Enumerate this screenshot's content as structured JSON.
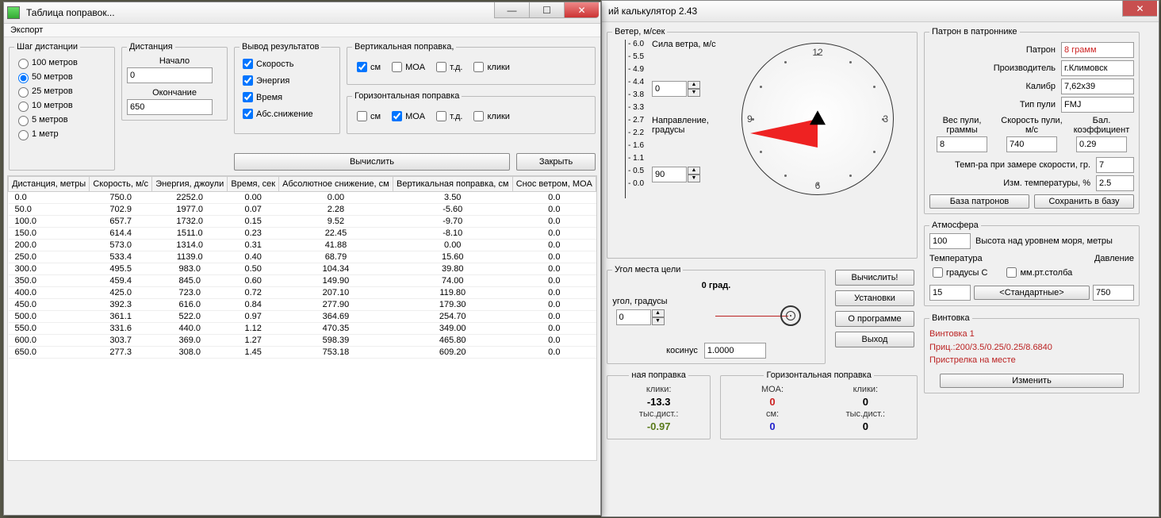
{
  "left_window": {
    "title": "Таблица поправок...",
    "menu_export": "Экспорт",
    "step": {
      "legend": "Шаг дистанции",
      "opts": [
        "100 метров",
        "50 метров",
        "25 метров",
        "10 метров",
        "5 метров",
        "1 метр"
      ],
      "selected": 1
    },
    "distance": {
      "legend": "Дистанция",
      "start_label": "Начало",
      "start_value": "0",
      "end_label": "Окончание",
      "end_value": "650"
    },
    "output": {
      "legend": "Вывод результатов",
      "opts": [
        "Скорость",
        "Энергия",
        "Время",
        "Абс.снижение"
      ]
    },
    "vert": {
      "legend": "Вертикальная поправка,",
      "opts": [
        "см",
        "MOA",
        "т.д.",
        "клики"
      ],
      "checked": 0
    },
    "horz": {
      "legend": "Горизонтальная поправка",
      "opts": [
        "см",
        "MOA",
        "т.д.",
        "клики"
      ],
      "checked": 1
    },
    "btn_calc": "Вычислить",
    "btn_close": "Закрыть",
    "columns": [
      "Дистанция, метры",
      "Скорость, м/с",
      "Энергия, джоули",
      "Время, сек",
      "Абсолютное снижение, см",
      "Вертикальная поправка, см",
      "Снос ветром, MOA"
    ],
    "rows": [
      [
        "0.0",
        "750.0",
        "2252.0",
        "0.00",
        "0.00",
        "3.50",
        "0.0"
      ],
      [
        "50.0",
        "702.9",
        "1977.0",
        "0.07",
        "2.28",
        "-5.60",
        "0.0"
      ],
      [
        "100.0",
        "657.7",
        "1732.0",
        "0.15",
        "9.52",
        "-9.70",
        "0.0"
      ],
      [
        "150.0",
        "614.4",
        "1511.0",
        "0.23",
        "22.45",
        "-8.10",
        "0.0"
      ],
      [
        "200.0",
        "573.0",
        "1314.0",
        "0.31",
        "41.88",
        "0.00",
        "0.0"
      ],
      [
        "250.0",
        "533.4",
        "1139.0",
        "0.40",
        "68.79",
        "15.60",
        "0.0"
      ],
      [
        "300.0",
        "495.5",
        "983.0",
        "0.50",
        "104.34",
        "39.80",
        "0.0"
      ],
      [
        "350.0",
        "459.4",
        "845.0",
        "0.60",
        "149.90",
        "74.00",
        "0.0"
      ],
      [
        "400.0",
        "425.0",
        "723.0",
        "0.72",
        "207.10",
        "119.80",
        "0.0"
      ],
      [
        "450.0",
        "392.3",
        "616.0",
        "0.84",
        "277.90",
        "179.30",
        "0.0"
      ],
      [
        "500.0",
        "361.1",
        "522.0",
        "0.97",
        "364.69",
        "254.70",
        "0.0"
      ],
      [
        "550.0",
        "331.6",
        "440.0",
        "1.12",
        "470.35",
        "349.00",
        "0.0"
      ],
      [
        "600.0",
        "303.7",
        "369.0",
        "1.27",
        "598.39",
        "465.80",
        "0.0"
      ],
      [
        "650.0",
        "277.3",
        "308.0",
        "1.45",
        "753.18",
        "609.20",
        "0.0"
      ]
    ]
  },
  "right_window": {
    "title": "ий калькулятор 2.43",
    "wind": {
      "legend": "Ветер, м/сек",
      "ticks": [
        "6.0",
        "5.5",
        "4.9",
        "4.4",
        "3.8",
        "3.3",
        "2.7",
        "2.2",
        "1.6",
        "1.1",
        "0.5",
        "0.0"
      ],
      "force_label": "Сила ветра, м/с",
      "force_value": "0",
      "dir_label": "Направление, градусы",
      "dir_value": "90",
      "clock_nums": {
        "12": "12",
        "3": "3",
        "6": "6",
        "9": "9"
      }
    },
    "angle": {
      "legend": "Угол места цели",
      "display": "0 град.",
      "angle_label": "угол, градусы",
      "angle_value": "0",
      "cos_label": "косинус",
      "cos_value": "1.0000"
    },
    "side_buttons": {
      "calc": "Вычислить!",
      "settings": "Установки",
      "about": "О программе",
      "exit": "Выход"
    },
    "vert_corr": {
      "legend": "ная поправка",
      "l1": "клики:",
      "v1": "-13.3",
      "l2": "тыс.дист.:",
      "v2": "-0.97"
    },
    "horz_corr": {
      "legend": "Горизонтальная поправка",
      "l1": "MOA:",
      "v1": "0",
      "l2": "см:",
      "v2": "0",
      "l3": "клики:",
      "v3": "0",
      "l4": "тыс.дист.:",
      "v4": "0"
    },
    "cartridge": {
      "legend": "Патрон в патроннике",
      "rows": {
        "patron_l": "Патрон",
        "patron_v": "8 грамм",
        "manuf_l": "Производитель",
        "manuf_v": "г.Климовск",
        "caliber_l": "Калибр",
        "caliber_v": "7,62x39",
        "bullet_type_l": "Тип пули",
        "bullet_type_v": "FMJ"
      },
      "b3": {
        "weight_l": "Вес пули, граммы",
        "weight_v": "8",
        "speed_l": "Скорость пули, м/с",
        "speed_v": "740",
        "bc_l": "Бал. коэффициент",
        "bc_v": "0.29"
      },
      "temp_l": "Темп-ра при замере скорости, гр.",
      "temp_v": "7",
      "dtemp_l": "Изм. температуры, %",
      "dtemp_v": "2.5",
      "btn_db": "База патронов",
      "btn_save": "Сохранить в базу"
    },
    "atmo": {
      "legend": "Атмосфера",
      "alt_v": "100",
      "alt_l": "Высота над уровнем моря, метры",
      "temp_l": "Температура",
      "pres_l": "Давление",
      "temp_unit": "градусы С",
      "pres_unit": "мм.рт.столба",
      "temp_v": "15",
      "btn_std": "<Стандартные>",
      "pres_v": "750"
    },
    "rifle": {
      "legend": "Винтовка",
      "line1": "Винтовка 1",
      "line2": "Приц.:200/3.5/0.25/0.25/8.6840",
      "line3": "Пристрелка на месте",
      "btn": "Изменить"
    }
  }
}
